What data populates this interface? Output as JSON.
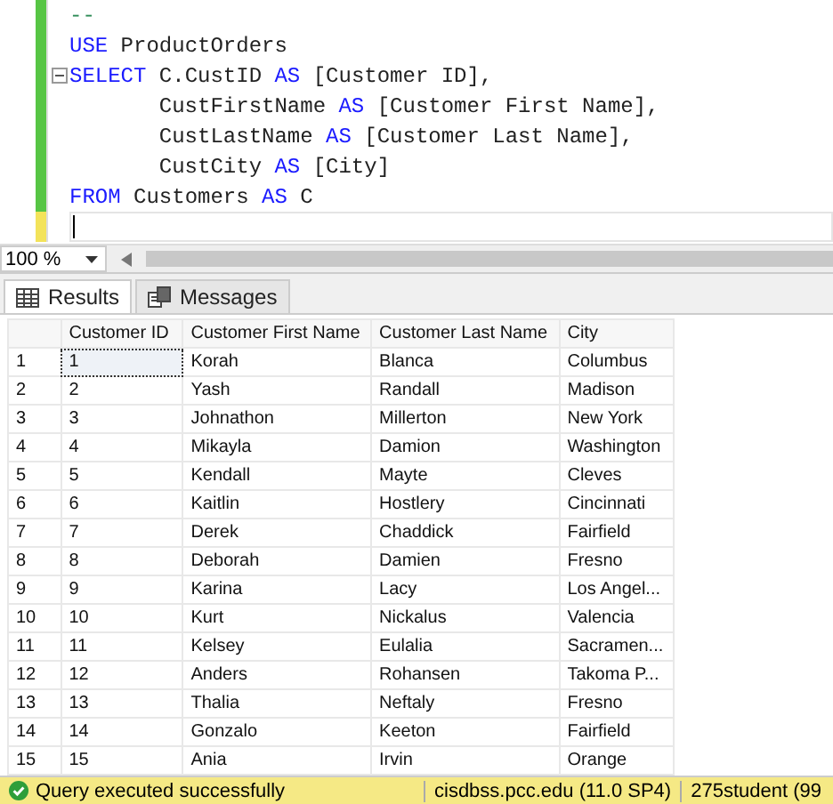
{
  "editor": {
    "lines": [
      {
        "saved": true,
        "fold": false,
        "tokens": [
          {
            "kind": "comment",
            "text": "--"
          }
        ]
      },
      {
        "saved": true,
        "fold": false,
        "tokens": [
          {
            "kind": "keyword",
            "text": "USE"
          },
          {
            "kind": "plain",
            "text": " ProductOrders"
          }
        ]
      },
      {
        "saved": true,
        "fold": true,
        "tokens": [
          {
            "kind": "keyword",
            "text": "SELECT"
          },
          {
            "kind": "plain",
            "text": " C.CustID "
          },
          {
            "kind": "keyword",
            "text": "AS"
          },
          {
            "kind": "plain",
            "text": " [Customer ID],"
          }
        ]
      },
      {
        "saved": true,
        "fold": false,
        "tokens": [
          {
            "kind": "plain",
            "text": "       CustFirstName "
          },
          {
            "kind": "keyword",
            "text": "AS"
          },
          {
            "kind": "plain",
            "text": " [Customer First Name],"
          }
        ]
      },
      {
        "saved": true,
        "fold": false,
        "tokens": [
          {
            "kind": "plain",
            "text": "       CustLastName "
          },
          {
            "kind": "keyword",
            "text": "AS"
          },
          {
            "kind": "plain",
            "text": " [Customer Last Name],"
          }
        ]
      },
      {
        "saved": true,
        "fold": false,
        "tokens": [
          {
            "kind": "plain",
            "text": "       CustCity "
          },
          {
            "kind": "keyword",
            "text": "AS"
          },
          {
            "kind": "plain",
            "text": " [City]"
          }
        ]
      },
      {
        "saved": true,
        "fold": false,
        "tokens": [
          {
            "kind": "keyword",
            "text": "FROM"
          },
          {
            "kind": "plain",
            "text": " Customers "
          },
          {
            "kind": "keyword",
            "text": "AS"
          },
          {
            "kind": "plain",
            "text": " C"
          }
        ]
      },
      {
        "saved": false,
        "fold": false
      }
    ]
  },
  "zoom": {
    "value": "100 %"
  },
  "tabs": [
    {
      "label": "Results",
      "kind": "grid",
      "selected": true
    },
    {
      "label": "Messages",
      "kind": "messages",
      "selected": false
    }
  ],
  "table": {
    "columns": [
      "Customer ID",
      "Customer First Name",
      "Customer Last Name",
      "City"
    ],
    "rows": [
      {
        "number": "1",
        "selected": true,
        "cells": [
          "1",
          "Korah",
          "Blanca",
          "Columbus"
        ]
      },
      {
        "number": "2",
        "selected": false,
        "cells": [
          "2",
          "Yash",
          "Randall",
          "Madison"
        ]
      },
      {
        "number": "3",
        "selected": false,
        "cells": [
          "3",
          "Johnathon",
          "Millerton",
          "New York"
        ]
      },
      {
        "number": "4",
        "selected": false,
        "cells": [
          "4",
          "Mikayla",
          "Damion",
          "Washington"
        ]
      },
      {
        "number": "5",
        "selected": false,
        "cells": [
          "5",
          "Kendall",
          "Mayte",
          "Cleves"
        ]
      },
      {
        "number": "6",
        "selected": false,
        "cells": [
          "6",
          "Kaitlin",
          "Hostlery",
          "Cincinnati"
        ]
      },
      {
        "number": "7",
        "selected": false,
        "cells": [
          "7",
          "Derek",
          "Chaddick",
          "Fairfield"
        ]
      },
      {
        "number": "8",
        "selected": false,
        "cells": [
          "8",
          "Deborah",
          "Damien",
          "Fresno"
        ]
      },
      {
        "number": "9",
        "selected": false,
        "cells": [
          "9",
          "Karina",
          "Lacy",
          "Los Angel..."
        ]
      },
      {
        "number": "10",
        "selected": false,
        "cells": [
          "10",
          "Kurt",
          "Nickalus",
          "Valencia"
        ]
      },
      {
        "number": "11",
        "selected": false,
        "cells": [
          "11",
          "Kelsey",
          "Eulalia",
          "Sacramen..."
        ]
      },
      {
        "number": "12",
        "selected": false,
        "cells": [
          "12",
          "Anders",
          "Rohansen",
          "Takoma P..."
        ]
      },
      {
        "number": "13",
        "selected": false,
        "cells": [
          "13",
          "Thalia",
          "Neftaly",
          "Fresno"
        ]
      },
      {
        "number": "14",
        "selected": false,
        "cells": [
          "14",
          "Gonzalo",
          "Keeton",
          "Fairfield"
        ]
      },
      {
        "number": "15",
        "selected": false,
        "cells": [
          "15",
          "Ania",
          "Irvin",
          "Orange"
        ]
      }
    ]
  },
  "status_bar": {
    "message": "Query executed successfully",
    "server": "cisdbss.pcc.edu (11.0 SP4)",
    "user": "275student (99"
  }
}
